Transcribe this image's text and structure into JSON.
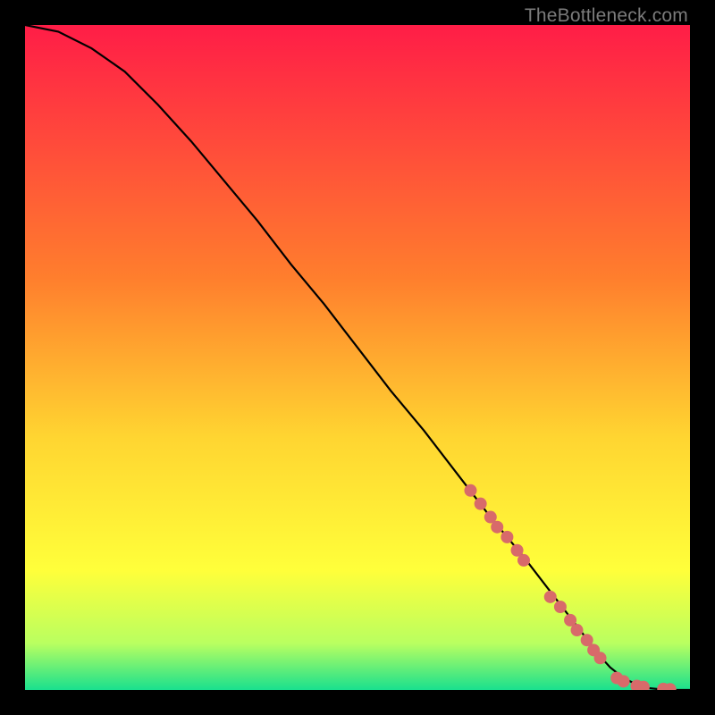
{
  "watermark": "TheBottleneck.com",
  "colors": {
    "top": "#ff1d47",
    "mid1": "#ff7e2d",
    "mid2": "#ffd531",
    "mid3": "#ffff3a",
    "mid4": "#b9ff60",
    "bottom": "#19e08e",
    "curve": "#000000",
    "dot": "#d86a6a"
  },
  "chart_data": {
    "type": "line",
    "title": "",
    "xlabel": "",
    "ylabel": "",
    "xlim": [
      0,
      100
    ],
    "ylim": [
      0,
      100
    ],
    "curve": {
      "x": [
        0,
        5,
        10,
        15,
        20,
        25,
        30,
        35,
        40,
        45,
        50,
        55,
        60,
        65,
        70,
        75,
        80,
        85,
        86,
        88,
        90,
        92,
        94,
        96,
        98,
        100
      ],
      "y": [
        100,
        99,
        96.5,
        93,
        88,
        82.5,
        76.5,
        70.5,
        64,
        58,
        51.5,
        45,
        39,
        32.5,
        26,
        20,
        13.5,
        7,
        5.6,
        3.4,
        1.8,
        0.8,
        0.25,
        0.05,
        0.0,
        0.0
      ]
    },
    "dots": {
      "x": [
        67,
        68.5,
        70,
        71,
        72.5,
        74,
        75,
        79,
        80.5,
        82,
        83,
        84.5,
        85.5,
        86.5,
        89,
        90,
        92,
        93,
        96,
        97
      ],
      "y": [
        30,
        28,
        26,
        24.5,
        23,
        21,
        19.5,
        14,
        12.5,
        10.5,
        9,
        7.5,
        6,
        4.8,
        1.8,
        1.3,
        0.6,
        0.45,
        0.15,
        0.1
      ]
    },
    "dot_radius_px": 7
  }
}
